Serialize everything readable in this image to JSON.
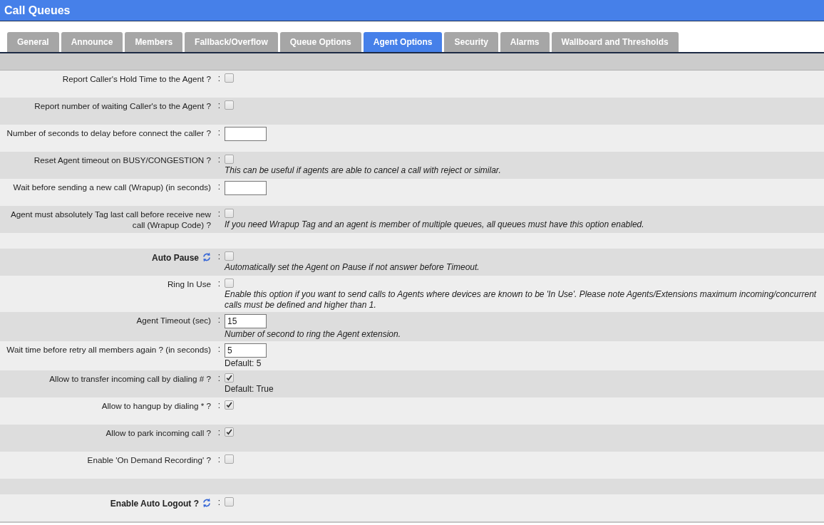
{
  "title": "Call Queues",
  "tabs": [
    {
      "label": "General",
      "selected": false
    },
    {
      "label": "Announce",
      "selected": false
    },
    {
      "label": "Members",
      "selected": false
    },
    {
      "label": "Fallback/Overflow",
      "selected": false
    },
    {
      "label": "Queue Options",
      "selected": false
    },
    {
      "label": "Agent Options",
      "selected": true
    },
    {
      "label": "Security",
      "selected": false
    },
    {
      "label": "Alarms",
      "selected": false
    },
    {
      "label": "Wallboard and Thresholds",
      "selected": false
    }
  ],
  "rows": [
    {
      "kind": "check",
      "label": "Report Caller's Hold Time to the Agent ?",
      "separator": ":",
      "checked": false
    },
    {
      "kind": "check",
      "label": "Report number of waiting Caller's to the Agent ?",
      "separator": ":",
      "checked": false
    },
    {
      "kind": "input",
      "label": "Number of seconds to delay before connect the caller ?",
      "separator": ":"
    },
    {
      "kind": "check",
      "label": "Reset Agent timeout on BUSY/CONGESTION ?",
      "separator": ":",
      "checked": false,
      "note": "This can be useful if agents are able to cancel a call with reject or similar."
    },
    {
      "kind": "input",
      "label": "Wait before sending a new call (Wrapup) (in seconds)",
      "separator": ":"
    },
    {
      "kind": "check",
      "label": "Agent must absolutely Tag last call before receive new call (Wrapup Code) ?",
      "separator": ":",
      "checked": false,
      "note": "If you need Wrapup Tag and an agent is member of multiple queues, all queues must have this option enabled."
    },
    {
      "kind": "spacer"
    },
    {
      "kind": "section",
      "label": "Auto Pause",
      "separator": ":",
      "checked": false,
      "note": "Automatically set the Agent on Pause if not answer before Timeout."
    },
    {
      "kind": "check",
      "label": "Ring In Use",
      "separator": ":",
      "checked": false,
      "note": "Enable this option if you want to send calls to Agents where devices are known to be 'In Use'. Please note Agents/Extensions maximum incoming/concurrent calls must be defined and higher than 1."
    },
    {
      "kind": "input",
      "label": "Agent Timeout (sec)",
      "separator": ":",
      "value": "15",
      "note": "Number of second to ring the Agent extension."
    },
    {
      "kind": "input",
      "label": "Wait time before retry all members again ? (in seconds)",
      "separator": ":",
      "value": "5",
      "default": "Default: 5"
    },
    {
      "kind": "check",
      "label": "Allow to transfer incoming call by dialing # ?",
      "separator": ":",
      "checked": true,
      "default": "Default: True"
    },
    {
      "kind": "check",
      "label": "Allow to hangup by dialing * ?",
      "separator": ":",
      "checked": true
    },
    {
      "kind": "check",
      "label": "Allow to park incoming call ?",
      "separator": ":",
      "checked": true
    },
    {
      "kind": "check",
      "label": "Enable 'On Demand Recording' ?",
      "separator": ":",
      "checked": false
    },
    {
      "kind": "spacer"
    },
    {
      "kind": "section",
      "label": "Enable Auto Logout ?",
      "separator": ":",
      "checked": false
    }
  ]
}
